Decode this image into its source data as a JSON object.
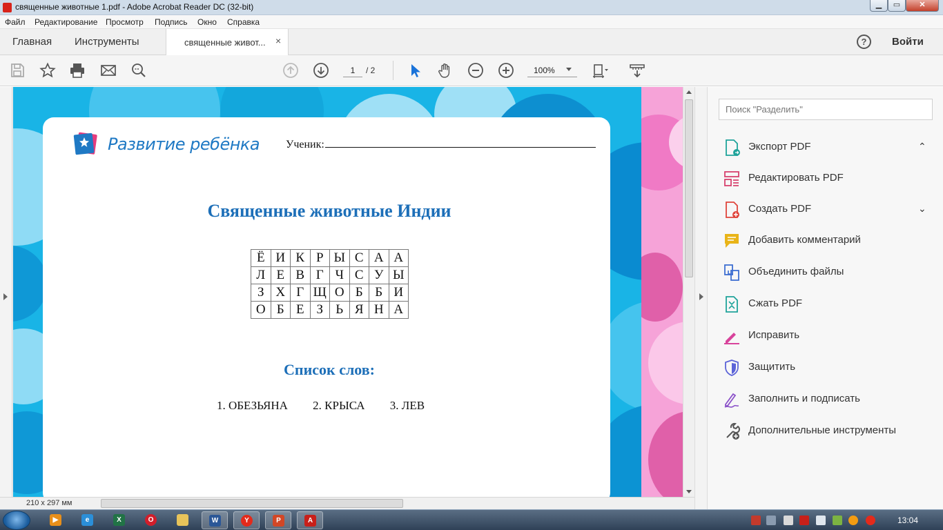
{
  "window": {
    "title": "священные животные 1.pdf - Adobe Acrobat Reader DC (32-bit)",
    "min_label": "▁",
    "max_label": "▭",
    "close_label": "✕"
  },
  "menu": [
    "Файл",
    "Редактирование",
    "Просмотр",
    "Подпись",
    "Окно",
    "Справка"
  ],
  "tabs": {
    "home": "Главная",
    "tools": "Инструменты",
    "document": "священные живот...",
    "close": "×",
    "help": "?",
    "signin": "Войти"
  },
  "toolbar": {
    "current_page": "1",
    "total_pages": "/ 2",
    "zoom": "100%"
  },
  "document": {
    "logo_text": "Развитие ребёнка",
    "student_label": "Ученик:",
    "title": "Священные животные Индии",
    "grid": [
      [
        "Ё",
        "И",
        "К",
        "Р",
        "Ы",
        "С",
        "А",
        "А"
      ],
      [
        "Л",
        "Е",
        "В",
        "Г",
        "Ч",
        "С",
        "У",
        "Ы"
      ],
      [
        "З",
        "Х",
        "Г",
        "Щ",
        "О",
        "Б",
        "Б",
        "И"
      ],
      [
        "О",
        "Б",
        "Е",
        "З",
        "Ь",
        "Я",
        "Н",
        "А"
      ]
    ],
    "word_list_title": "Список слов:",
    "words": [
      "1. ОБЕЗЬЯНА",
      "2. КРЫСА",
      "3. ЛЕВ"
    ]
  },
  "status": {
    "page_size": "210 x 297 мм"
  },
  "right_panel": {
    "search_placeholder": "Поиск \"Разделить\"",
    "tools": [
      {
        "label": "Экспорт PDF",
        "icon": "export-pdf-icon",
        "color": "#1fa39a",
        "chevron": "⌃"
      },
      {
        "label": "Редактировать PDF",
        "icon": "edit-pdf-icon",
        "color": "#d7416e",
        "chevron": ""
      },
      {
        "label": "Создать PDF",
        "icon": "create-pdf-icon",
        "color": "#e0443b",
        "chevron": "⌄"
      },
      {
        "label": "Добавить комментарий",
        "icon": "comment-icon",
        "color": "#e9b418",
        "chevron": ""
      },
      {
        "label": "Объединить файлы",
        "icon": "combine-files-icon",
        "color": "#3e6fd1",
        "chevron": ""
      },
      {
        "label": "Сжать PDF",
        "icon": "compress-pdf-icon",
        "color": "#1fa39a",
        "chevron": ""
      },
      {
        "label": "Исправить",
        "icon": "fix-pen-icon",
        "color": "#d8439b",
        "chevron": ""
      },
      {
        "label": "Защитить",
        "icon": "shield-icon",
        "color": "#5b63d8",
        "chevron": ""
      },
      {
        "label": "Заполнить и подписать",
        "icon": "fill-sign-icon",
        "color": "#8b51c9",
        "chevron": ""
      },
      {
        "label": "Дополнительные инструменты",
        "icon": "more-tools-icon",
        "color": "#555555",
        "chevron": ""
      }
    ]
  },
  "taskbar": {
    "clock": "13:04"
  }
}
